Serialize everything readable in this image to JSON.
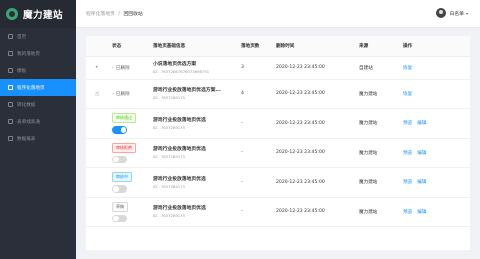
{
  "app": {
    "logo_text": "魔力建站"
  },
  "sidebar": {
    "items": [
      {
        "label": "首页"
      },
      {
        "label": "我的落地页"
      },
      {
        "label": "模板"
      },
      {
        "label": "程序化落地页"
      },
      {
        "label": "转化数据"
      },
      {
        "label": "表单线索通"
      },
      {
        "label": "数据报表"
      }
    ],
    "active_index": 3
  },
  "header": {
    "breadcrumb_parent": "程序化落地页",
    "breadcrumb_sep": "/",
    "breadcrumb_current": "回回收站",
    "user_name": "白名单",
    "caret": "▾"
  },
  "table": {
    "columns": [
      "",
      "状态",
      "落地页基础信息",
      "落地页数",
      "删除时间",
      "来源",
      "操作"
    ],
    "rows": [
      {
        "expander": "▸",
        "status": "已删除",
        "title": "小说落地页优选方案",
        "id": "ID：76372867676373898791",
        "count": "3",
        "time": "2020-12-23 23:45:00",
        "source": "自建站",
        "actions": [
          "恢复"
        ]
      },
      {
        "expander": "☝",
        "status": "已删除",
        "title": "游戏行业投放落地页优选方案...",
        "id": "ID：7637289175",
        "count": "4",
        "time": "2020-12-23 23:45:00",
        "source": "魔力建站",
        "actions": [
          "恢复"
        ]
      },
      {
        "tag": "审核通过",
        "tag_kind": "ok",
        "switch_on": true,
        "title": "游戏行业投放落地页优选",
        "id": "ID：7637289175",
        "count": "-",
        "time": "2020-12-23 23:45:00",
        "source": "魔力建站",
        "actions": [
          "预览",
          "编辑"
        ]
      },
      {
        "tag": "审核拒绝",
        "tag_kind": "rej",
        "switch_on": false,
        "title": "游戏行业投放落地页优选",
        "id": "ID：7637289175",
        "count": "-",
        "time": "2020-12-23 23:45:00",
        "source": "魔力建站",
        "actions": [
          "预览",
          "编辑"
        ]
      },
      {
        "tag": "审核中",
        "tag_kind": "pend",
        "switch_on": false,
        "title": "游戏行业投放落地页优选",
        "id": "ID：7637289175",
        "count": "-",
        "time": "2020-12-23 23:45:00",
        "source": "魔力建站",
        "actions": [
          "预览",
          "编辑"
        ]
      },
      {
        "tag": "草稿",
        "tag_kind": "draft",
        "switch_on": false,
        "title": "游戏行业投放落地页优选",
        "id": "ID：7637289175",
        "count": "-",
        "time": "2020-12-23 23:45:00",
        "source": "魔力建站",
        "actions": [
          "预览",
          "编辑"
        ]
      }
    ]
  }
}
